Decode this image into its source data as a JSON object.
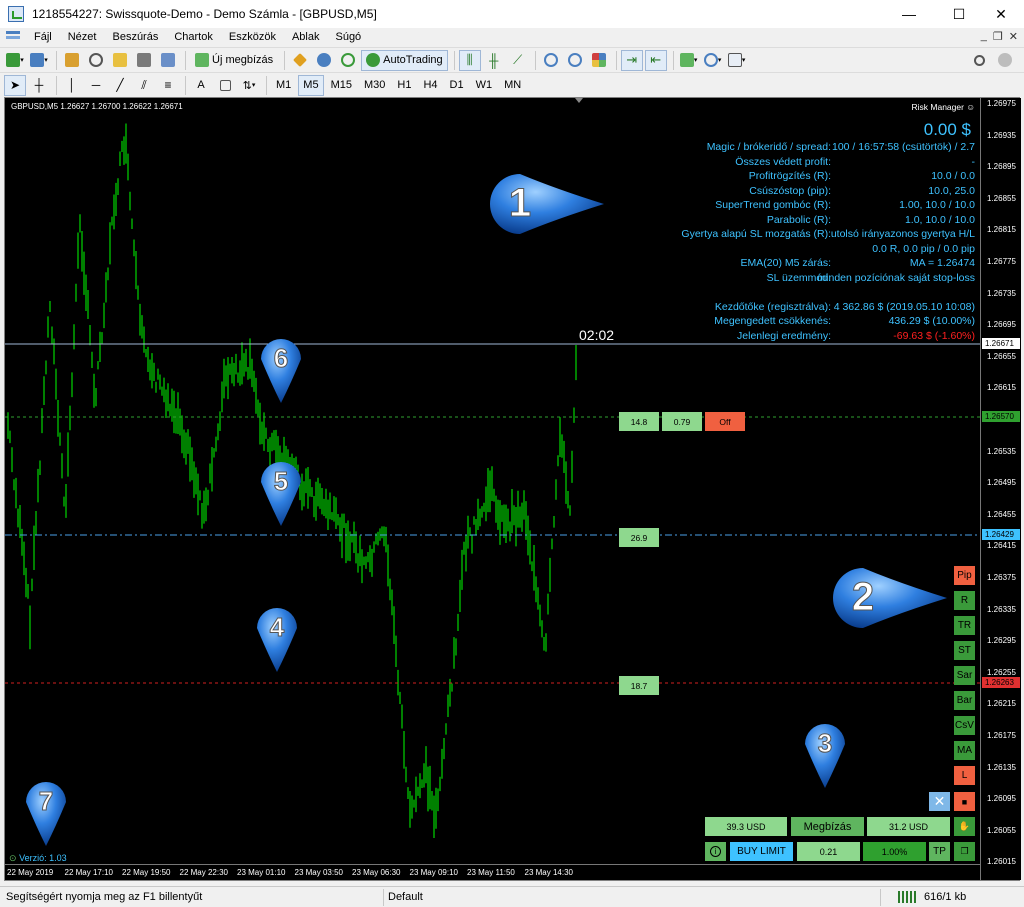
{
  "window": {
    "title": "1218554227: Swissquote-Demo - Demo Számla - [GBPUSD,M5]",
    "minimize": "—",
    "maximize": "☐",
    "close": "✕"
  },
  "menu": {
    "items": [
      "Fájl",
      "Nézet",
      "Beszúrás",
      "Chartok",
      "Eszközök",
      "Ablak",
      "Súgó"
    ]
  },
  "toolbar1": {
    "new_order": "Új megbízás",
    "autotrading": "AutoTrading"
  },
  "toolbar2": {
    "timeframes": [
      "M1",
      "M5",
      "M15",
      "M30",
      "H1",
      "H4",
      "D1",
      "W1",
      "MN"
    ],
    "active_timeframe": "M5",
    "text_tool": "A"
  },
  "chart": {
    "header": "GBPUSD,M5  1.26627 1.26700 1.26622 1.26671",
    "risk_manager": "Risk Manager",
    "risk_manager_icon": "smiley-icon",
    "profit_display": "0.00 $",
    "countdown": "02:02",
    "version": "Verzió: 1.03",
    "colors": {
      "bg": "#000000",
      "candle": "#00ff00",
      "info": "#3ec2ff",
      "loss": "#ff2020",
      "bid_line": "#9fb7d6"
    }
  },
  "info_rows": [
    {
      "label": "Magic / brókeridő / spread:",
      "value": "100 / 16:57:58 (csütörtök) / 2.7"
    },
    {
      "label": "Összes védett profit:",
      "value": "-"
    },
    {
      "label": "Profitrögzítés (R):",
      "value": "10.0 / 0.0"
    },
    {
      "label": "Csúszóstop (pip):",
      "value": "10.0, 25.0"
    },
    {
      "label": "SuperTrend gombóc (R):",
      "value": "1.00, 10.0 / 10.0"
    },
    {
      "label": "Parabolic (R):",
      "value": "1.0, 10.0 / 10.0"
    },
    {
      "label": "Gyertya alapú SL mozgatás (R):",
      "value": "utolsó irányazonos gyertya H/L"
    },
    {
      "label": "",
      "value": "0.0 R, 0.0 pip / 0.0 pip"
    },
    {
      "label": "EMA(20) M5 zárás:",
      "value": "MA = 1.26474"
    },
    {
      "label": "SL üzemmód:",
      "value": "minden pozíciónak saját stop-loss"
    },
    {
      "label": "",
      "value": ""
    },
    {
      "label": "Kezdőtőke (regisztrálva):",
      "value": "4 362.86 $ (2019.05.10 10:08)"
    },
    {
      "label": "Megengedett csökkenés:",
      "value": "436.29 $ (10.00%)"
    },
    {
      "label": "Jelenlegi eredmény:",
      "value": "-69.63 $ (-1.60%)"
    }
  ],
  "price_axis": {
    "ticks": [
      "1.26975",
      "1.26935",
      "1.26895",
      "1.26855",
      "1.26815",
      "1.26775",
      "1.26735",
      "1.26695",
      "1.26655",
      "1.26615",
      "1.26575",
      "1.26535",
      "1.26495",
      "1.26455",
      "1.26415",
      "1.26375",
      "1.26335",
      "1.26295",
      "1.26255",
      "1.26215",
      "1.26175",
      "1.26135",
      "1.26095",
      "1.26055",
      "1.26015"
    ],
    "current": "1.26671",
    "tag_green": "1.26570",
    "tag_blue": "1.26429",
    "tag_red": "1.26263"
  },
  "time_axis": {
    "ticks": [
      "22 May 2019",
      "22 May 17:10",
      "22 May 19:50",
      "22 May 22:30",
      "23 May 01:10",
      "23 May 03:50",
      "23 May 06:30",
      "23 May 09:10",
      "23 May 11:50",
      "23 May 14:30"
    ]
  },
  "line_buttons": {
    "green_line": [
      "14.8",
      "0.79",
      "Off"
    ],
    "blue_line": "26.9",
    "red_line": "18.7"
  },
  "side_buttons": [
    "Pip",
    "R",
    "TR",
    "ST",
    "Sar",
    "Bar",
    "CsV",
    "MA",
    "L"
  ],
  "order_panel": {
    "sell_value": "39.3 USD",
    "title": "Megbízás",
    "buy_value": "31.2 USD",
    "info_icon": "info-icon",
    "order_type": "BUY LIMIT",
    "lots": "0.21",
    "risk": "1.00%",
    "tp": "TP"
  },
  "markers": [
    "1",
    "2",
    "3",
    "4",
    "5",
    "6",
    "7"
  ],
  "status": {
    "help": "Segítségért nyomja meg az F1 billentyűt",
    "profile": "Default",
    "traffic": "616/1 kb"
  }
}
